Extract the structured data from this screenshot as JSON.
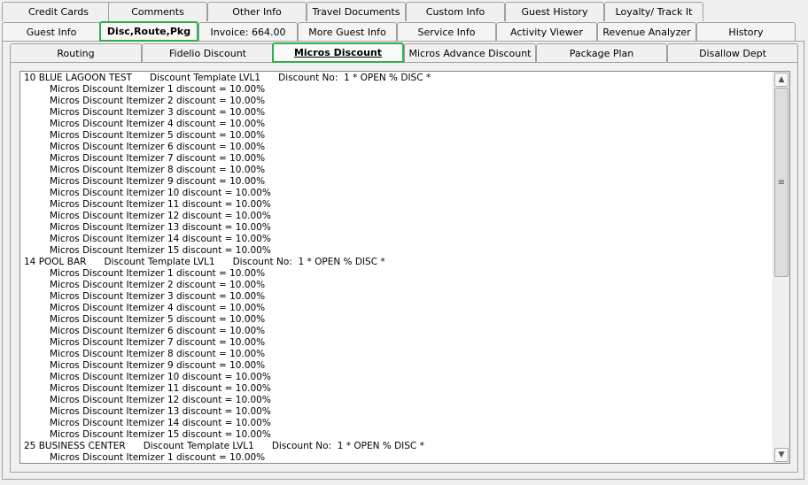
{
  "tabs": {
    "row1": [
      "Credit Cards",
      "Comments",
      "Other Info",
      "Travel Documents",
      "Custom Info",
      "Guest History",
      "Loyalty/ Track It"
    ],
    "row2": [
      "Guest Info",
      "Disc,Route,Pkg",
      "Invoice: 664.00",
      "More Guest Info",
      "Service Info",
      "Activity Viewer",
      "Revenue Analyzer",
      "History"
    ],
    "row3": [
      "Routing",
      "Fidelio Discount",
      "Micros Discount",
      "Micros Advance Discount",
      "Package Plan",
      "Disallow Dept"
    ],
    "selected_row2": "Disc,Route,Pkg",
    "selected_row3": "Micros Discount"
  },
  "accent_color": "#2fb04a",
  "discount_text": [
    {
      "header": true,
      "text": "10 BLUE LAGOON TEST      Discount Template LVL1      Discount No:  1 * OPEN % DISC *"
    },
    {
      "header": false,
      "text": "Micros Discount Itemizer 1 discount = 10.00%"
    },
    {
      "header": false,
      "text": "Micros Discount Itemizer 2 discount = 10.00%"
    },
    {
      "header": false,
      "text": "Micros Discount Itemizer 3 discount = 10.00%"
    },
    {
      "header": false,
      "text": "Micros Discount Itemizer 4 discount = 10.00%"
    },
    {
      "header": false,
      "text": "Micros Discount Itemizer 5 discount = 10.00%"
    },
    {
      "header": false,
      "text": "Micros Discount Itemizer 6 discount = 10.00%"
    },
    {
      "header": false,
      "text": "Micros Discount Itemizer 7 discount = 10.00%"
    },
    {
      "header": false,
      "text": "Micros Discount Itemizer 8 discount = 10.00%"
    },
    {
      "header": false,
      "text": "Micros Discount Itemizer 9 discount = 10.00%"
    },
    {
      "header": false,
      "text": "Micros Discount Itemizer 10 discount = 10.00%"
    },
    {
      "header": false,
      "text": "Micros Discount Itemizer 11 discount = 10.00%"
    },
    {
      "header": false,
      "text": "Micros Discount Itemizer 12 discount = 10.00%"
    },
    {
      "header": false,
      "text": "Micros Discount Itemizer 13 discount = 10.00%"
    },
    {
      "header": false,
      "text": "Micros Discount Itemizer 14 discount = 10.00%"
    },
    {
      "header": false,
      "text": "Micros Discount Itemizer 15 discount = 10.00%"
    },
    {
      "header": true,
      "text": "14 POOL BAR      Discount Template LVL1      Discount No:  1 * OPEN % DISC *"
    },
    {
      "header": false,
      "text": "Micros Discount Itemizer 1 discount = 10.00%"
    },
    {
      "header": false,
      "text": "Micros Discount Itemizer 2 discount = 10.00%"
    },
    {
      "header": false,
      "text": "Micros Discount Itemizer 3 discount = 10.00%"
    },
    {
      "header": false,
      "text": "Micros Discount Itemizer 4 discount = 10.00%"
    },
    {
      "header": false,
      "text": "Micros Discount Itemizer 5 discount = 10.00%"
    },
    {
      "header": false,
      "text": "Micros Discount Itemizer 6 discount = 10.00%"
    },
    {
      "header": false,
      "text": "Micros Discount Itemizer 7 discount = 10.00%"
    },
    {
      "header": false,
      "text": "Micros Discount Itemizer 8 discount = 10.00%"
    },
    {
      "header": false,
      "text": "Micros Discount Itemizer 9 discount = 10.00%"
    },
    {
      "header": false,
      "text": "Micros Discount Itemizer 10 discount = 10.00%"
    },
    {
      "header": false,
      "text": "Micros Discount Itemizer 11 discount = 10.00%"
    },
    {
      "header": false,
      "text": "Micros Discount Itemizer 12 discount = 10.00%"
    },
    {
      "header": false,
      "text": "Micros Discount Itemizer 13 discount = 10.00%"
    },
    {
      "header": false,
      "text": "Micros Discount Itemizer 14 discount = 10.00%"
    },
    {
      "header": false,
      "text": "Micros Discount Itemizer 15 discount = 10.00%"
    },
    {
      "header": true,
      "text": "25 BUSINESS CENTER      Discount Template LVL1      Discount No:  1 * OPEN % DISC *"
    },
    {
      "header": false,
      "text": "Micros Discount Itemizer 1 discount = 10.00%"
    }
  ],
  "scrollbar": {
    "up_icon": "▲",
    "down_icon": "▼",
    "grip_icon": "≡"
  }
}
